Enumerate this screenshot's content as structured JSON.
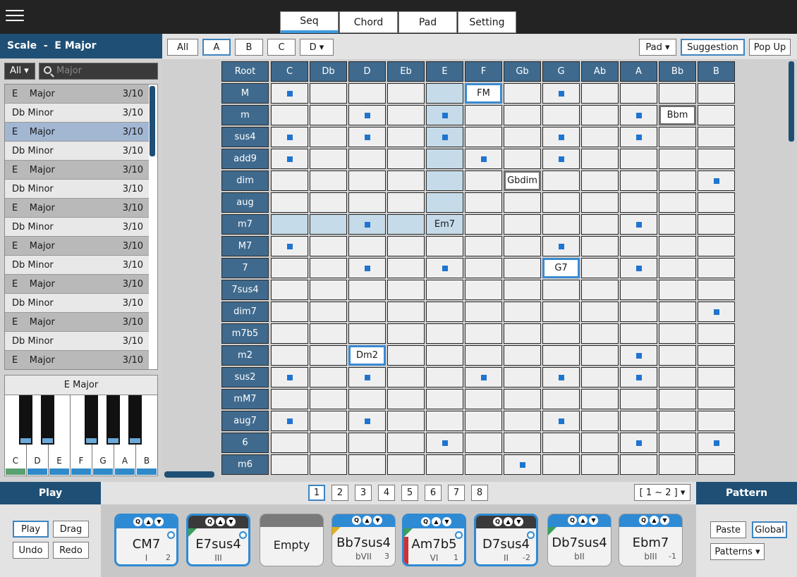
{
  "top_tabs": [
    {
      "label": "Seq",
      "active": true
    },
    {
      "label": "Chord",
      "active": false
    },
    {
      "label": "Pad",
      "active": false
    },
    {
      "label": "Setting",
      "active": false
    }
  ],
  "scale_panel": {
    "title": "Scale  -  E Major",
    "filter_value": "All",
    "search_placeholder": "Major",
    "rows": [
      {
        "label": "E    Major",
        "count": "3/10",
        "shade": "a"
      },
      {
        "label": "Db Minor",
        "count": "3/10",
        "shade": "b"
      },
      {
        "label": "E    Major",
        "count": "3/10",
        "shade": "sel"
      },
      {
        "label": "Db Minor",
        "count": "3/10",
        "shade": "b"
      },
      {
        "label": "E    Major",
        "count": "3/10",
        "shade": "a"
      },
      {
        "label": "Db Minor",
        "count": "3/10",
        "shade": "b"
      },
      {
        "label": "E    Major",
        "count": "3/10",
        "shade": "a"
      },
      {
        "label": "Db Minor",
        "count": "3/10",
        "shade": "b"
      },
      {
        "label": "E    Major",
        "count": "3/10",
        "shade": "a"
      },
      {
        "label": "Db Minor",
        "count": "3/10",
        "shade": "b"
      },
      {
        "label": "E    Major",
        "count": "3/10",
        "shade": "a"
      },
      {
        "label": "Db Minor",
        "count": "3/10",
        "shade": "b"
      },
      {
        "label": "E    Major",
        "count": "3/10",
        "shade": "a"
      },
      {
        "label": "Db Minor",
        "count": "3/10",
        "shade": "b"
      },
      {
        "label": "E    Major",
        "count": "3/10",
        "shade": "a"
      }
    ]
  },
  "piano": {
    "title": "E Major",
    "white_keys": [
      "C",
      "D",
      "E",
      "F",
      "G",
      "A",
      "B"
    ]
  },
  "filter_bar": {
    "buttons": [
      {
        "label": "All",
        "active": false
      },
      {
        "label": "A",
        "active": true
      },
      {
        "label": "B",
        "active": false
      },
      {
        "label": "C",
        "active": false
      },
      {
        "label": "D ▾",
        "active": false
      }
    ],
    "pad_select": "Pad ▾",
    "suggestion": "Suggestion",
    "popup": "Pop Up"
  },
  "grid": {
    "root_label": "Root",
    "columns": [
      "C",
      "Db",
      "D",
      "Eb",
      "E",
      "F",
      "Gb",
      "G",
      "Ab",
      "A",
      "Bb",
      "B"
    ],
    "rows": [
      "M",
      "m",
      "sus4",
      "add9",
      "dim",
      "aug",
      "m7",
      "M7",
      "7",
      "7sus4",
      "dim7",
      "m7b5",
      "m2",
      "sus2",
      "mM7",
      "aug7",
      "6",
      "m6"
    ],
    "dots": [
      [
        0,
        0
      ],
      [
        0,
        7
      ],
      [
        1,
        2
      ],
      [
        1,
        4
      ],
      [
        1,
        9
      ],
      [
        2,
        0
      ],
      [
        2,
        2
      ],
      [
        2,
        4
      ],
      [
        2,
        7
      ],
      [
        2,
        9
      ],
      [
        3,
        0
      ],
      [
        3,
        5
      ],
      [
        3,
        7
      ],
      [
        4,
        11
      ],
      [
        6,
        2
      ],
      [
        6,
        9
      ],
      [
        7,
        0
      ],
      [
        7,
        7
      ],
      [
        8,
        2
      ],
      [
        8,
        4
      ],
      [
        8,
        9
      ],
      [
        10,
        11
      ],
      [
        12,
        9
      ],
      [
        13,
        0
      ],
      [
        13,
        2
      ],
      [
        13,
        5
      ],
      [
        13,
        7
      ],
      [
        13,
        9
      ],
      [
        15,
        0
      ],
      [
        15,
        2
      ],
      [
        15,
        7
      ],
      [
        16,
        4
      ],
      [
        16,
        9
      ],
      [
        16,
        11
      ],
      [
        17,
        6
      ]
    ],
    "highlights": [
      [
        0,
        4
      ],
      [
        1,
        4
      ],
      [
        2,
        4
      ],
      [
        3,
        4
      ],
      [
        4,
        4
      ],
      [
        5,
        4
      ],
      [
        6,
        0
      ],
      [
        6,
        1
      ],
      [
        6,
        2
      ],
      [
        6,
        3
      ],
      [
        6,
        4
      ]
    ],
    "labels": [
      {
        "r": 0,
        "c": 5,
        "text": "FM",
        "style": "bl"
      },
      {
        "r": 1,
        "c": 10,
        "text": "Bbm",
        "style": "gr"
      },
      {
        "r": 4,
        "c": 6,
        "text": "Gbdim",
        "style": "gr"
      },
      {
        "r": 6,
        "c": 4,
        "text": "Em7",
        "style": "nb"
      },
      {
        "r": 8,
        "c": 7,
        "text": "G7",
        "style": "bl"
      },
      {
        "r": 12,
        "c": 2,
        "text": "Dm2",
        "style": "bl"
      }
    ]
  },
  "play_panel": {
    "title": "Play",
    "play": "Play",
    "drag": "Drag",
    "undo": "Undo",
    "redo": "Redo"
  },
  "pages": {
    "items": [
      "1",
      "2",
      "3",
      "4",
      "5",
      "6",
      "7",
      "8"
    ],
    "active": "1",
    "range": "[ 1 ~ 2 ] ▾"
  },
  "cards": [
    {
      "name": "CM7",
      "degree": "I",
      "offset": "2",
      "bar": "blue",
      "selected": true,
      "check": true,
      "accent": ""
    },
    {
      "name": "E7sus4",
      "degree": "III",
      "offset": "",
      "bar": "dark",
      "selected": true,
      "check": true,
      "accent": "tri-green"
    },
    {
      "name": "Empty",
      "degree": "",
      "offset": "",
      "bar": "gray",
      "selected": false,
      "check": false,
      "accent": "",
      "empty": true
    },
    {
      "name": "Bb7sus4",
      "degree": "bVII",
      "offset": "3",
      "bar": "blue",
      "selected": false,
      "check": false,
      "accent": "tri-yellow"
    },
    {
      "name": "Am7b5",
      "degree": "VI",
      "offset": "1",
      "bar": "blue",
      "selected": true,
      "check": true,
      "accent": "red-strip"
    },
    {
      "name": "D7sus4",
      "degree": "II",
      "offset": "-2",
      "bar": "dark",
      "selected": true,
      "check": true,
      "accent": ""
    },
    {
      "name": "Db7sus4",
      "degree": "bII",
      "offset": "",
      "bar": "blue",
      "selected": false,
      "check": false,
      "accent": "tri-green"
    },
    {
      "name": "Ebm7",
      "degree": "bIII",
      "offset": "-1",
      "bar": "blue",
      "selected": false,
      "check": false,
      "accent": ""
    }
  ],
  "card_buttons": [
    "Q",
    "▲",
    "▼"
  ],
  "pattern_panel": {
    "title": "Pattern",
    "paste": "Paste",
    "global": "Global",
    "patterns": "Patterns ▾"
  },
  "colors": {
    "accent": "#2f8ad4",
    "header_blue": "#1f4f75",
    "grid_header": "#3f6a8e",
    "dot": "#1f74d0"
  }
}
